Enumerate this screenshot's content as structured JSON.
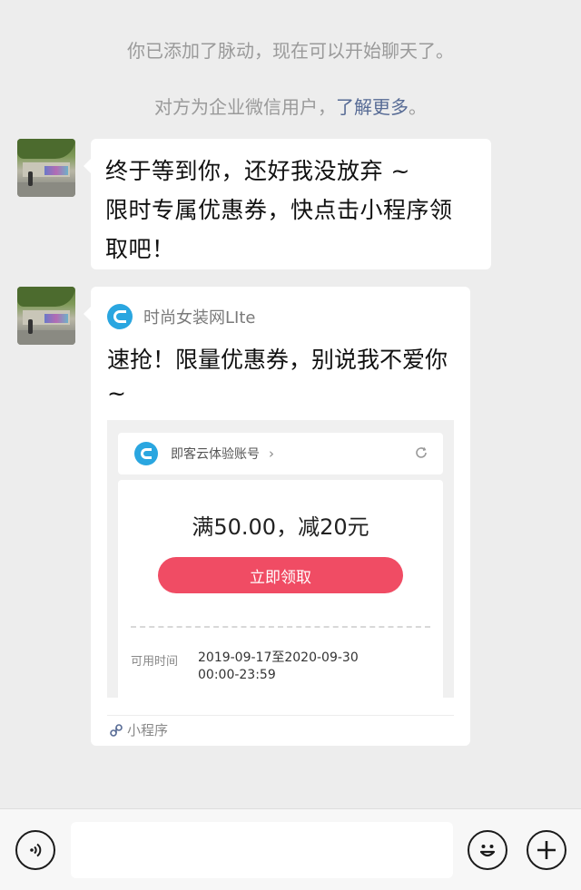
{
  "system": {
    "added_notice": "你已添加了脉动，现在可以开始聊天了。",
    "enterprise_prefix": "对方为企业微信用户，",
    "learn_more": "了解更多",
    "enterprise_suffix": "。"
  },
  "messages": [
    {
      "type": "text",
      "lines": [
        "终于等到你，还好我没放弃 ~",
        "限时专属优惠券，快点击小程序领",
        "取吧！"
      ]
    },
    {
      "type": "mini_program_card",
      "app_name": "时尚女装网LIte",
      "title": "速抢！限量优惠券，别说我不爱你~",
      "preview": {
        "account_name": "即客云体验账号",
        "chevron": "›",
        "coupon_amount": "满50.00，减20元",
        "claim_button": "立即领取",
        "valid_label": "可用时间",
        "valid_dates": "2019-09-17至2020-09-30",
        "valid_hours": "00:00-23:59"
      },
      "footer_label": "小程序"
    }
  ],
  "input_bar": {
    "voice_icon": "voice-icon",
    "emoji_icon": "emoji-icon",
    "plus_icon": "plus-icon"
  },
  "colors": {
    "background": "#ededed",
    "link": "#576b95",
    "brand_blue": "#2aa6e0",
    "claim_red": "#f04c64"
  }
}
